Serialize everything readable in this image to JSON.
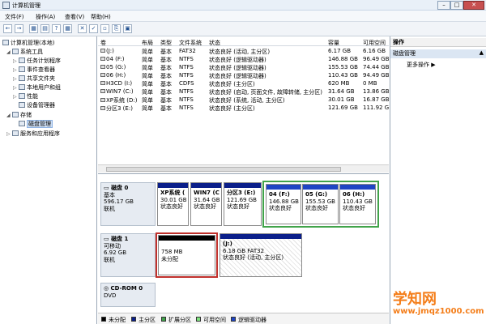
{
  "window": {
    "title": "计算机管理",
    "min_label": "–",
    "max_label": "□",
    "close_label": "✕"
  },
  "menu": [
    "文件(F)",
    "操作(A)",
    "查看(V)",
    "帮助(H)"
  ],
  "toolbar": [
    "←",
    "→",
    "▦",
    "▤",
    "?",
    "▦",
    "✕",
    "✓",
    "▫",
    "⎘",
    "▣"
  ],
  "nav": {
    "root": "计算机管理(本地)",
    "items": [
      {
        "label": "系统工具",
        "indent": 1,
        "twisty": "◢"
      },
      {
        "label": "任务计划程序",
        "indent": 2,
        "twisty": "▷"
      },
      {
        "label": "事件查看器",
        "indent": 2,
        "twisty": "▷"
      },
      {
        "label": "共享文件夹",
        "indent": 2,
        "twisty": "▷"
      },
      {
        "label": "本地用户和组",
        "indent": 2,
        "twisty": "▷"
      },
      {
        "label": "性能",
        "indent": 2,
        "twisty": "▷"
      },
      {
        "label": "设备管理器",
        "indent": 2,
        "twisty": ""
      },
      {
        "label": "存储",
        "indent": 1,
        "twisty": "◢"
      },
      {
        "label": "磁盘管理",
        "indent": 2,
        "twisty": "",
        "selected": true
      },
      {
        "label": "服务和应用程序",
        "indent": 1,
        "twisty": "▷"
      }
    ]
  },
  "volume_list": {
    "columns": [
      "卷",
      "布局",
      "类型",
      "文件系统",
      "状态",
      "容量",
      "可用空间"
    ],
    "rows": [
      [
        "(J:)",
        "简单",
        "基本",
        "FAT32",
        "状态良好 (活动, 主分区)",
        "6.17 GB",
        "6.16 GB"
      ],
      [
        "04 (F:)",
        "简单",
        "基本",
        "NTFS",
        "状态良好 (逻辑驱动器)",
        "146.88 GB",
        "96.49 GB"
      ],
      [
        "05 (G:)",
        "简单",
        "基本",
        "NTFS",
        "状态良好 (逻辑驱动器)",
        "155.53 GB",
        "74.44 GB"
      ],
      [
        "06 (H:)",
        "简单",
        "基本",
        "NTFS",
        "状态良好 (逻辑驱动器)",
        "110.43 GB",
        "94.49 GB"
      ],
      [
        "H3CD (I:)",
        "简单",
        "基本",
        "CDFS",
        "状态良好 (主分区)",
        "620 MB",
        "0 MB"
      ],
      [
        "WIN7 (C:)",
        "简单",
        "基本",
        "NTFS",
        "状态良好 (启动, 页面文件, 故障转储, 主分区)",
        "31.64 GB",
        "13.86 GB"
      ],
      [
        "XP系统 (D:)",
        "简单",
        "基本",
        "NTFS",
        "状态良好 (系统, 活动, 主分区)",
        "30.01 GB",
        "16.87 GB"
      ],
      [
        "分区3 (E:)",
        "简单",
        "基本",
        "NTFS",
        "状态良好 (主分区)",
        "121.69 GB",
        "111.92 GB"
      ]
    ]
  },
  "disk0": {
    "name": "磁盘 0",
    "type": "基本",
    "size": "596.17 GB",
    "status": "联机",
    "partitions": [
      {
        "name": "XP系统 (",
        "size": "30.01 GB",
        "status": "状态良好"
      },
      {
        "name": "WIN7 (C",
        "size": "31.64 GB",
        "status": "状态良好"
      },
      {
        "name": "分区3 (E:)",
        "size": "121.69 GB",
        "status": "状态良好"
      },
      {
        "name": "04 (F:)",
        "size": "146.88 GB",
        "status": "状态良好"
      },
      {
        "name": "05 (G:)",
        "size": "155.53 GB",
        "status": "状态良好"
      },
      {
        "name": "06 (H:)",
        "size": "110.43 GB",
        "status": "状态良好"
      }
    ]
  },
  "disk1": {
    "name": "磁盘 1",
    "type": "可移动",
    "size": "6.92 GB",
    "status": "联机",
    "unallocated": {
      "size": "758 MB",
      "status": "未分配"
    },
    "partition": {
      "name": "(J:)",
      "size": "6.18 GB FAT32",
      "status": "状态良好 (活动, 主分区)"
    }
  },
  "cdrom0": {
    "name": "CD-ROM 0",
    "type": "DVD"
  },
  "legend": [
    {
      "label": "未分配",
      "color": "#000000"
    },
    {
      "label": "主分区",
      "color": "#0b1f8a"
    },
    {
      "label": "扩展分区",
      "color": "#41a34a"
    },
    {
      "label": "可用空间",
      "color": "#7ee27e"
    },
    {
      "label": "逻辑驱动器",
      "color": "#1f45c4"
    }
  ],
  "actions": {
    "header": "操作",
    "section": "磁盘管理",
    "more": "更多操作"
  },
  "watermark": {
    "line1": "学知网",
    "line2": "www.jmqz1000.com"
  }
}
